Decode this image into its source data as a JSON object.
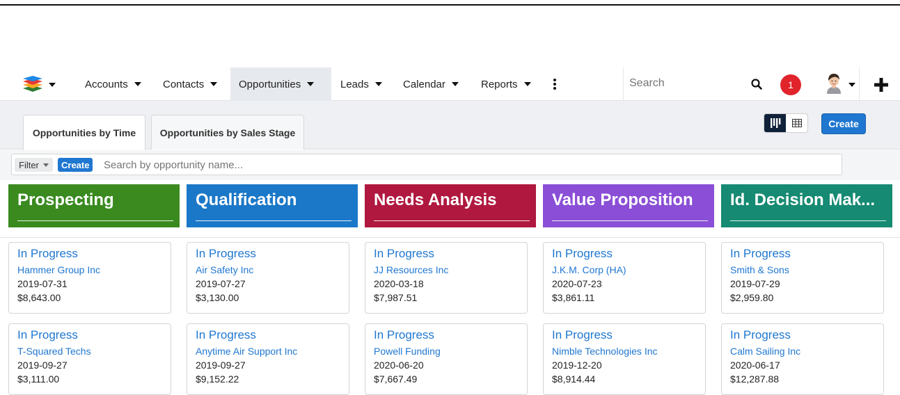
{
  "nav": {
    "items": [
      {
        "label": "Accounts"
      },
      {
        "label": "Contacts"
      },
      {
        "label": "Opportunities"
      },
      {
        "label": "Leads"
      },
      {
        "label": "Calendar"
      },
      {
        "label": "Reports"
      }
    ],
    "search_placeholder": "Search",
    "notification_count": "1"
  },
  "tabs": [
    {
      "label": "Opportunities by Time"
    },
    {
      "label": "Opportunities by Sales Stage"
    }
  ],
  "toolbar": {
    "create_label": "Create"
  },
  "filter": {
    "label": "Filter",
    "create_label": "Create",
    "placeholder": "Search by opportunity name..."
  },
  "columns": [
    {
      "title": "Prospecting",
      "color": "#3a8a1f",
      "cards": [
        {
          "status": "In Progress",
          "account": "Hammer Group Inc",
          "date": "2019-07-31",
          "amount": "$8,643.00"
        },
        {
          "status": "In Progress",
          "account": "T-Squared Techs",
          "date": "2019-09-27",
          "amount": "$3,111.00"
        }
      ]
    },
    {
      "title": "Qualification",
      "color": "#1b78c8",
      "cards": [
        {
          "status": "In Progress",
          "account": "Air Safety Inc",
          "date": "2019-07-27",
          "amount": "$3,130.00"
        },
        {
          "status": "In Progress",
          "account": "Anytime Air Support Inc",
          "date": "2019-09-27",
          "amount": "$9,152.22"
        }
      ]
    },
    {
      "title": "Needs Analysis",
      "color": "#b0183f",
      "cards": [
        {
          "status": "In Progress",
          "account": "JJ Resources Inc",
          "date": "2020-03-18",
          "amount": "$7,987.51"
        },
        {
          "status": "In Progress",
          "account": "Powell Funding",
          "date": "2020-06-20",
          "amount": "$7,667.49"
        }
      ]
    },
    {
      "title": "Value Proposition",
      "color": "#8a4fd6",
      "cards": [
        {
          "status": "In Progress",
          "account": "J.K.M. Corp (HA)",
          "date": "2020-07-23",
          "amount": "$3,861.11"
        },
        {
          "status": "In Progress",
          "account": "Nimble Technologies Inc",
          "date": "2019-12-20",
          "amount": "$8,914.44"
        }
      ]
    },
    {
      "title": "Id. Decision Mak...",
      "color": "#168a72",
      "cards": [
        {
          "status": "In Progress",
          "account": "Smith & Sons",
          "date": "2019-07-29",
          "amount": "$2,959.80"
        },
        {
          "status": "In Progress",
          "account": "Calm Sailing Inc",
          "date": "2020-06-17",
          "amount": "$12,287.88"
        }
      ]
    }
  ]
}
